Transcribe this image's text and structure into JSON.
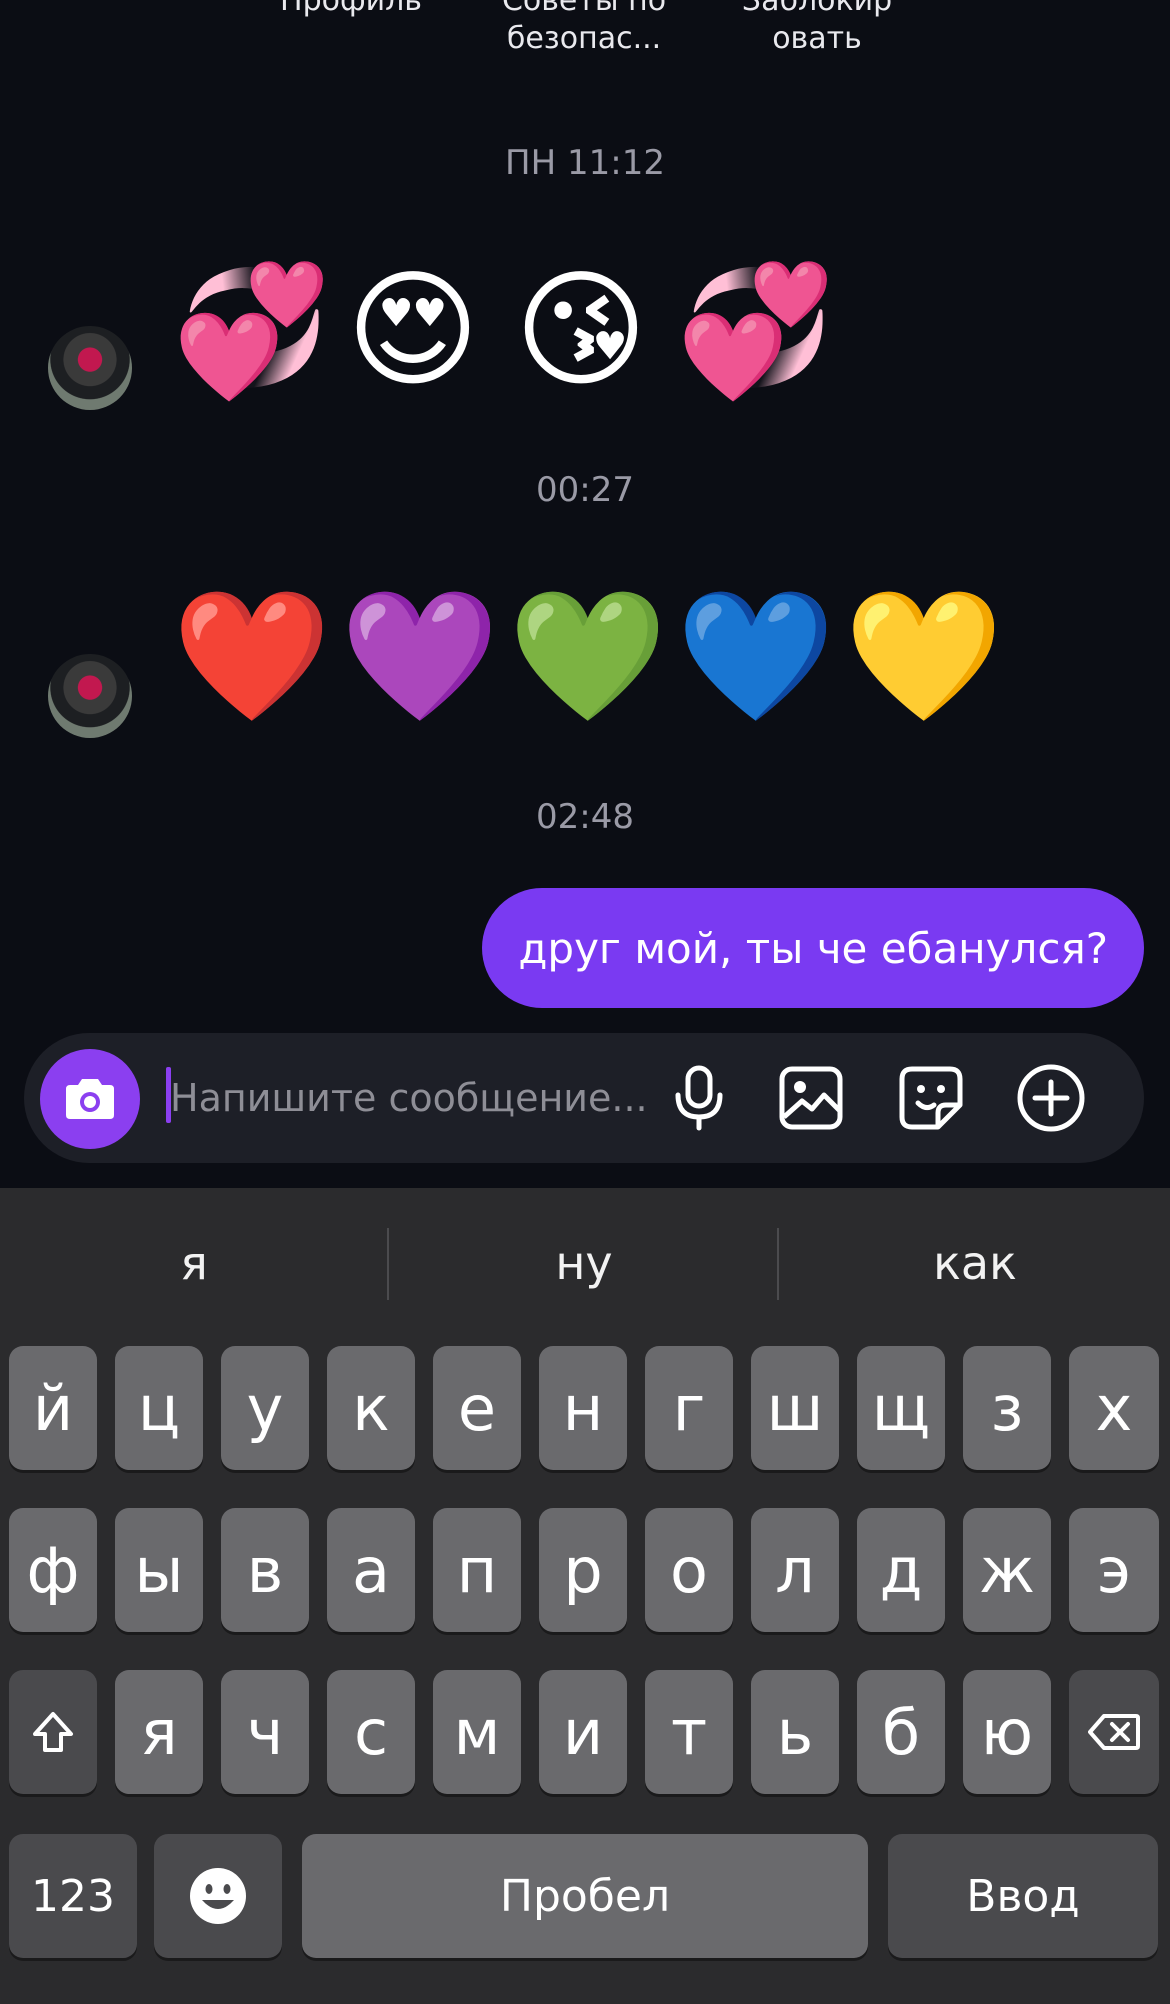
{
  "top_actions": [
    "Профиль",
    "Советы по\nбезопас...",
    "Заблокир\nовать"
  ],
  "timestamps": [
    "ПН 11:12",
    "00:27",
    "02:48"
  ],
  "incoming_1": {
    "emojis": [
      "💞",
      "😍",
      "😘",
      "💞"
    ]
  },
  "incoming_2": {
    "emojis": [
      "❤️",
      "💜",
      "💚",
      "💙",
      "💛"
    ]
  },
  "outgoing_message": "друг мой, ты че ебанулся?",
  "composer": {
    "placeholder": "Напишите сообщение...",
    "icons": [
      "camera-icon",
      "microphone-icon",
      "image-icon",
      "sticker-icon",
      "plus-circle-icon"
    ]
  },
  "keyboard": {
    "suggestions": [
      "я",
      "ну",
      "как"
    ],
    "row1": [
      "й",
      "ц",
      "у",
      "к",
      "е",
      "н",
      "г",
      "ш",
      "щ",
      "з",
      "х"
    ],
    "row2": [
      "ф",
      "ы",
      "в",
      "а",
      "п",
      "р",
      "о",
      "л",
      "д",
      "ж",
      "э"
    ],
    "row3": [
      "я",
      "ч",
      "с",
      "м",
      "и",
      "т",
      "ь",
      "б",
      "ю"
    ],
    "numbers_key": "123",
    "space_key": "Пробел",
    "return_key": "Ввод",
    "icons": [
      "shift-icon",
      "backspace-icon",
      "emoji-icon"
    ]
  },
  "colors": {
    "background": "#0b0d14",
    "accent_purple": "#7a3af2",
    "keyboard_bg": "#2b2b2d",
    "key_bg": "#6a6a6d"
  }
}
